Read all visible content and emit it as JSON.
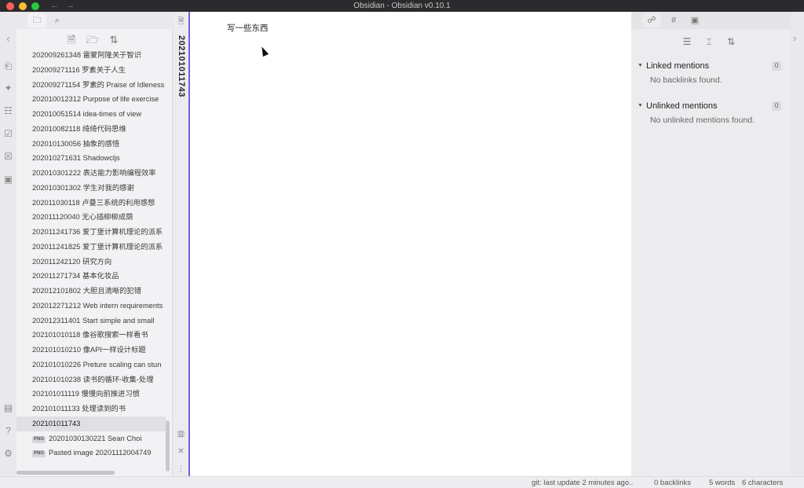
{
  "window": {
    "title": "Obsidian - Obsidian v0.10.1",
    "back_arrow": "←",
    "forward_arrow": "→"
  },
  "left_tabs": {
    "files_icon": "folder-icon",
    "search_icon": "search-icon",
    "files_glyph": "🗀",
    "search_glyph": "⌕"
  },
  "ribbon": {
    "collapse_glyph": "‹",
    "icons": [
      {
        "name": "open-quick-switcher-icon",
        "glyph": "⎗"
      },
      {
        "name": "graph-view-icon",
        "glyph": "✦"
      },
      {
        "name": "templates-icon",
        "glyph": "☷"
      },
      {
        "name": "daily-note-icon",
        "glyph": "☑"
      },
      {
        "name": "archive-icon",
        "glyph": "☒"
      },
      {
        "name": "calendar-icon",
        "glyph": "▣"
      }
    ],
    "bottom": [
      {
        "name": "open-vault-icon",
        "glyph": "▤"
      },
      {
        "name": "help-icon",
        "glyph": "?"
      },
      {
        "name": "settings-icon",
        "glyph": "⚙"
      }
    ]
  },
  "explorer": {
    "actions": [
      {
        "name": "new-note-icon",
        "glyph": "🗎"
      },
      {
        "name": "new-folder-icon",
        "glyph": "🗁"
      },
      {
        "name": "sort-icon",
        "glyph": "⇅"
      }
    ],
    "files": [
      {
        "label": "202009261348 雷蒙阿隆关于智识",
        "type": "md"
      },
      {
        "label": "202009271116 罗素关于人生",
        "type": "md"
      },
      {
        "label": "202009271154 罗素的 Praise of Idleness",
        "type": "md"
      },
      {
        "label": "202010012312 Purpose of life exercise",
        "type": "md"
      },
      {
        "label": "202010051514 idea-times of view",
        "type": "md"
      },
      {
        "label": "202010082118 绮绮代码思维",
        "type": "md"
      },
      {
        "label": "202010130056 抽象的感悟",
        "type": "md"
      },
      {
        "label": "202010271631 Shadowcljs",
        "type": "md"
      },
      {
        "label": "202010301222 表达能力影响编程效率",
        "type": "md"
      },
      {
        "label": "202010301302 学生对我的感谢",
        "type": "md"
      },
      {
        "label": "202011030118 卢曼三系统的利用感想",
        "type": "md"
      },
      {
        "label": "202011120040 无心插柳柳成荫",
        "type": "md"
      },
      {
        "label": "202011241736 爱丁堡计算机理论的派系",
        "type": "md"
      },
      {
        "label": "202011241825 爱丁堡计算机理论的派系",
        "type": "md"
      },
      {
        "label": "202011242120 研究方向",
        "type": "md"
      },
      {
        "label": "202011271734 基本化妆品",
        "type": "md"
      },
      {
        "label": "202012101802 大胆且清晰的犯错",
        "type": "md"
      },
      {
        "label": "202012271212 Web intern requirements",
        "type": "md"
      },
      {
        "label": "202012311401 Start simple and small",
        "type": "md"
      },
      {
        "label": "202101010118 像谷歌搜索一样看书",
        "type": "md"
      },
      {
        "label": "202101010210 像API一样设计标题",
        "type": "md"
      },
      {
        "label": "202101010226 Preture scaling can stun",
        "type": "md"
      },
      {
        "label": "202101010238 读书的循环-收集-处理",
        "type": "md"
      },
      {
        "label": "202101011119 慢慢向前推进习惯",
        "type": "md"
      },
      {
        "label": "202101011133 处理读到的书",
        "type": "md"
      },
      {
        "label": "202101011743",
        "type": "md",
        "active": true
      },
      {
        "label": "20201030130221 Sean Choi",
        "type": "png",
        "badge": "PNG"
      },
      {
        "label": "Pasted image 20201112004749",
        "type": "png",
        "badge": "PNG"
      }
    ]
  },
  "tab": {
    "title": "202101011743",
    "file_glyph": "🗎",
    "bottom_icons": [
      {
        "name": "sidebar-toggle-icon",
        "glyph": "▥"
      },
      {
        "name": "close-icon",
        "glyph": "✕"
      },
      {
        "name": "more-options-icon",
        "glyph": "⋮"
      }
    ]
  },
  "editor": {
    "content": "写一些东西"
  },
  "right_tabs": {
    "tabs": [
      {
        "name": "backlinks-icon",
        "glyph": "☍"
      },
      {
        "name": "tags-icon",
        "glyph": "#"
      },
      {
        "name": "calendar-icon",
        "glyph": "▣"
      }
    ]
  },
  "backlinks": {
    "actions": [
      {
        "name": "collapse-results-icon",
        "glyph": "☰"
      },
      {
        "name": "show-more-context-icon",
        "glyph": "⌶"
      },
      {
        "name": "sort-icon",
        "glyph": "⇅"
      }
    ],
    "arrow": "▼",
    "linked": {
      "title": "Linked mentions",
      "count": "0",
      "empty": "No backlinks found."
    },
    "unlinked": {
      "title": "Unlinked mentions",
      "count": "0",
      "empty": "No unlinked mentions found."
    }
  },
  "right_edge": {
    "expand_glyph": "›"
  },
  "statusbar": {
    "git": "git: last update 2 minutes ago..",
    "backlinks": "0 backlinks",
    "words": "5 words",
    "characters": "6 characters"
  }
}
